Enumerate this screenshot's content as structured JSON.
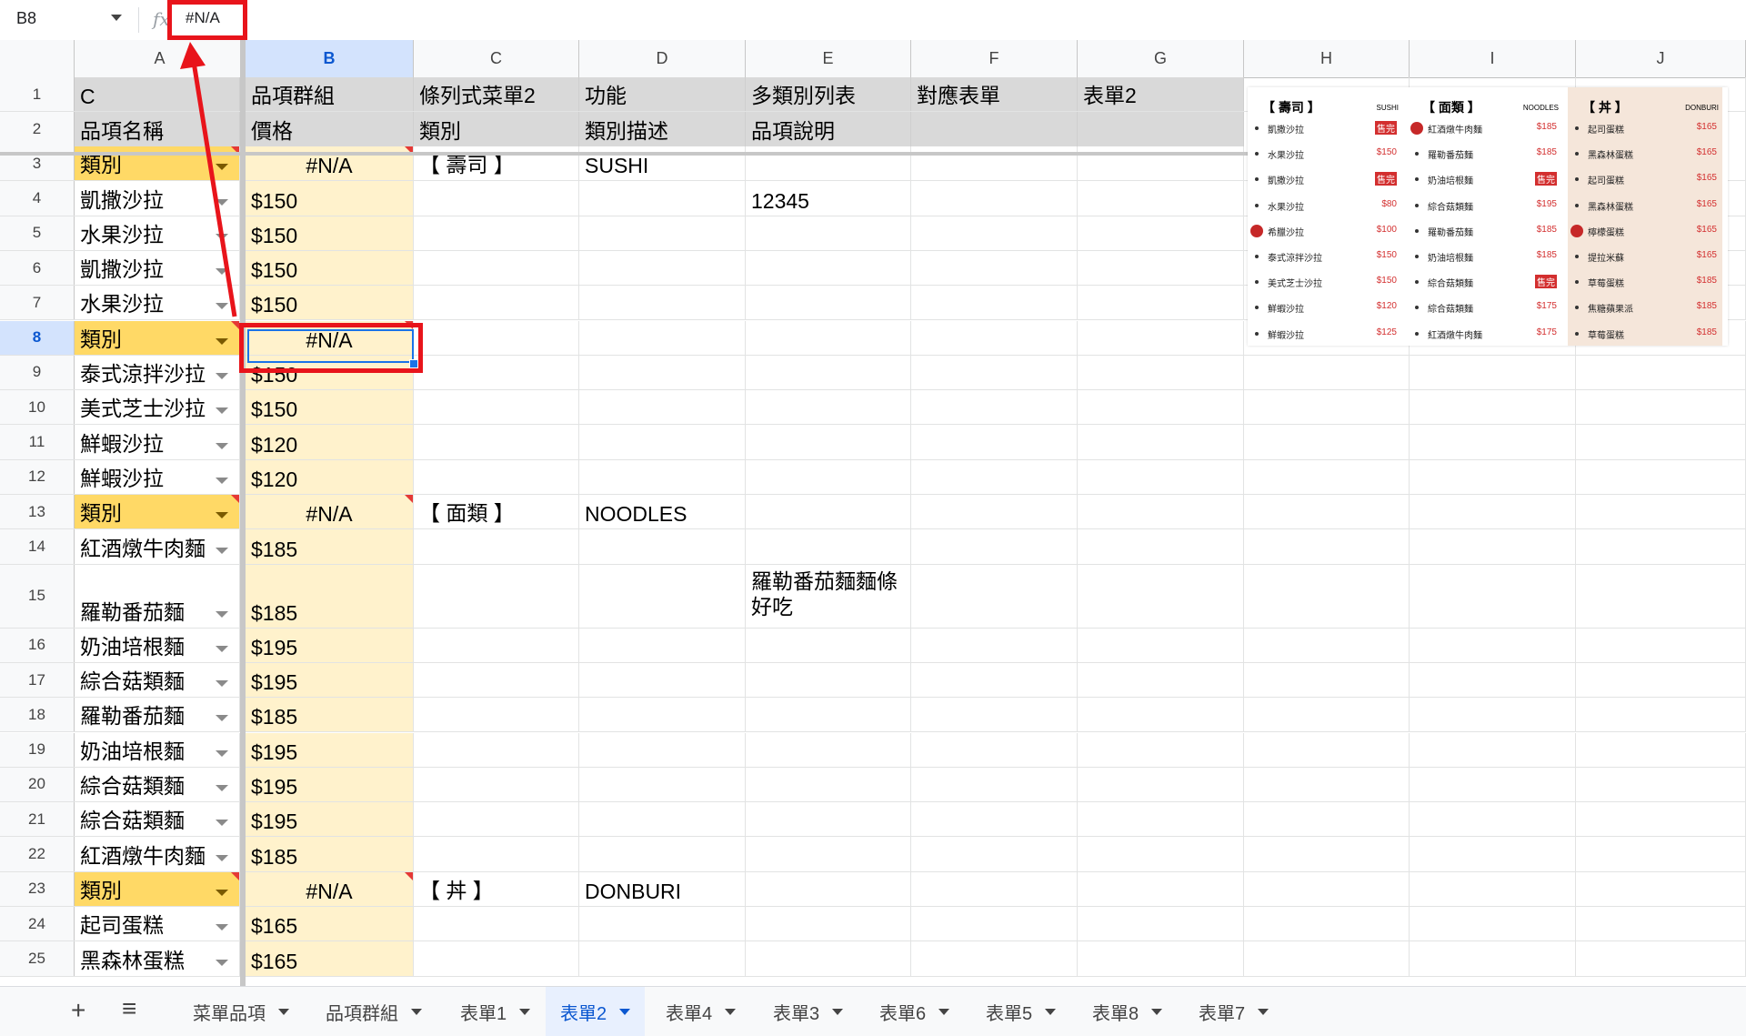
{
  "formula_bar": {
    "name_box": "B8",
    "fx": "fx",
    "value": "#N/A"
  },
  "columns": [
    "A",
    "B",
    "C",
    "D",
    "E",
    "F",
    "G",
    "H",
    "I",
    "J"
  ],
  "rows": [
    {
      "n": "1",
      "a": "C",
      "b": "品項群組",
      "c": "條列式菜單2",
      "d": "功能",
      "e": "多類別列表",
      "f": "對應表單",
      "g": "表單2"
    },
    {
      "n": "2",
      "a": "品項名稱",
      "b": "價格",
      "c": "類別",
      "d": "類別描述",
      "e": "品項說明",
      "f": "",
      "g": ""
    },
    {
      "n": "3",
      "a": "類別",
      "b": "#N/A",
      "c": "【 壽司 】",
      "d": "SUSHI",
      "e": ""
    },
    {
      "n": "4",
      "a": "凱撒沙拉",
      "b": "$150",
      "c": "",
      "d": "",
      "e": "12345"
    },
    {
      "n": "5",
      "a": "水果沙拉",
      "b": "$150",
      "c": "",
      "d": "",
      "e": ""
    },
    {
      "n": "6",
      "a": "凱撒沙拉",
      "b": "$150",
      "c": "",
      "d": "",
      "e": ""
    },
    {
      "n": "7",
      "a": "水果沙拉",
      "b": "$150",
      "c": "",
      "d": "",
      "e": ""
    },
    {
      "n": "8",
      "a": "類別",
      "b": "#N/A",
      "c": "",
      "d": "",
      "e": ""
    },
    {
      "n": "9",
      "a": "泰式涼拌沙拉",
      "b": "$150",
      "c": "",
      "d": "",
      "e": ""
    },
    {
      "n": "10",
      "a": "美式芝士沙拉",
      "b": "$150",
      "c": "",
      "d": "",
      "e": ""
    },
    {
      "n": "11",
      "a": "鮮蝦沙拉",
      "b": "$120",
      "c": "",
      "d": "",
      "e": ""
    },
    {
      "n": "12",
      "a": "鮮蝦沙拉",
      "b": "$120",
      "c": "",
      "d": "",
      "e": ""
    },
    {
      "n": "13",
      "a": "類別",
      "b": "#N/A",
      "c": "【 面類 】",
      "d": "NOODLES",
      "e": ""
    },
    {
      "n": "14",
      "a": "紅酒燉牛肉麵",
      "b": "$185",
      "c": "",
      "d": "",
      "e": ""
    },
    {
      "n": "15",
      "a": "羅勒番茄麵",
      "b": "$185",
      "c": "",
      "d": "",
      "e": "羅勒番茄麵麵條好吃"
    },
    {
      "n": "16",
      "a": "奶油培根麵",
      "b": "$195",
      "c": "",
      "d": "",
      "e": ""
    },
    {
      "n": "17",
      "a": "綜合菇類麵",
      "b": "$195",
      "c": "",
      "d": "",
      "e": ""
    },
    {
      "n": "18",
      "a": "羅勒番茄麵",
      "b": "$185",
      "c": "",
      "d": "",
      "e": ""
    },
    {
      "n": "19",
      "a": "奶油培根麵",
      "b": "$195",
      "c": "",
      "d": "",
      "e": ""
    },
    {
      "n": "20",
      "a": "綜合菇類麵",
      "b": "$195",
      "c": "",
      "d": "",
      "e": ""
    },
    {
      "n": "21",
      "a": "綜合菇類麵",
      "b": "$195",
      "c": "",
      "d": "",
      "e": ""
    },
    {
      "n": "22",
      "a": "紅酒燉牛肉麵",
      "b": "$185",
      "c": "",
      "d": "",
      "e": ""
    },
    {
      "n": "23",
      "a": "類別",
      "b": "#N/A",
      "c": "【 丼 】",
      "d": "DONBURI",
      "e": ""
    },
    {
      "n": "24",
      "a": "起司蛋糕",
      "b": "$165",
      "c": "",
      "d": "",
      "e": ""
    },
    {
      "n": "25",
      "a": "黑森林蛋糕",
      "b": "$165",
      "c": "",
      "d": "",
      "e": ""
    }
  ],
  "menu_image": {
    "columns": [
      {
        "title": "【 壽司 】",
        "sub": "SUSHI",
        "items": [
          {
            "name": "凱撒沙拉",
            "price": "售完",
            "sold": true
          },
          {
            "name": "水果沙拉",
            "price": "$150"
          },
          {
            "name": "凱撒沙拉",
            "price": "售完",
            "sold": true
          },
          {
            "name": "水果沙拉",
            "price": "$80"
          },
          {
            "name": "希臘沙拉",
            "price": "$100",
            "badge": true
          },
          {
            "name": "泰式涼拌沙拉",
            "price": "$150"
          },
          {
            "name": "美式芝士沙拉",
            "price": "$150"
          },
          {
            "name": "鮮蝦沙拉",
            "price": "$120"
          },
          {
            "name": "鮮蝦沙拉",
            "price": "$125"
          }
        ]
      },
      {
        "title": "【 面類 】",
        "sub": "NOODLES",
        "items": [
          {
            "name": "紅酒燉牛肉麵",
            "price": "$185",
            "badge": true
          },
          {
            "name": "羅勒番茄麵",
            "price": "$185"
          },
          {
            "name": "奶油培根麵",
            "price": "售完",
            "sold": true
          },
          {
            "name": "綜合菇類麵",
            "price": "$195"
          },
          {
            "name": "羅勒番茄麵",
            "price": "$185"
          },
          {
            "name": "奶油培根麵",
            "price": "$185"
          },
          {
            "name": "綜合菇類麵",
            "price": "售完",
            "sold": true
          },
          {
            "name": "綜合菇類麵",
            "price": "$175"
          },
          {
            "name": "紅酒燉牛肉麵",
            "price": "$175"
          }
        ]
      },
      {
        "title": "【 丼 】",
        "sub": "DONBURI",
        "items": [
          {
            "name": "起司蛋糕",
            "price": "$165"
          },
          {
            "name": "黑森林蛋糕",
            "price": "$165"
          },
          {
            "name": "起司蛋糕",
            "price": "$165"
          },
          {
            "name": "黑森林蛋糕",
            "price": "$165"
          },
          {
            "name": "檸檬蛋糕",
            "price": "$165",
            "badge": true
          },
          {
            "name": "提拉米蘇",
            "price": "$165"
          },
          {
            "name": "草莓蛋糕",
            "price": "$185"
          },
          {
            "name": "焦糖蘋果派",
            "price": "$185"
          },
          {
            "name": "草莓蛋糕",
            "price": "$185"
          }
        ]
      }
    ]
  },
  "tabs": [
    {
      "label": "菜單品項"
    },
    {
      "label": "品項群組"
    },
    {
      "label": "表單1"
    },
    {
      "label": "表單2",
      "active": true
    },
    {
      "label": "表單4"
    },
    {
      "label": "表單3"
    },
    {
      "label": "表單6"
    },
    {
      "label": "表單5"
    },
    {
      "label": "表單8"
    },
    {
      "label": "表單7"
    }
  ],
  "tab_icons": {
    "add": "+",
    "menu": "≡"
  },
  "colors": {
    "selection": "#1a73e8",
    "highlight_box": "#e8141b",
    "category_fill": "#ffd966",
    "price_fill": "#fff2cc",
    "header_fill": "#d9d9d9"
  }
}
